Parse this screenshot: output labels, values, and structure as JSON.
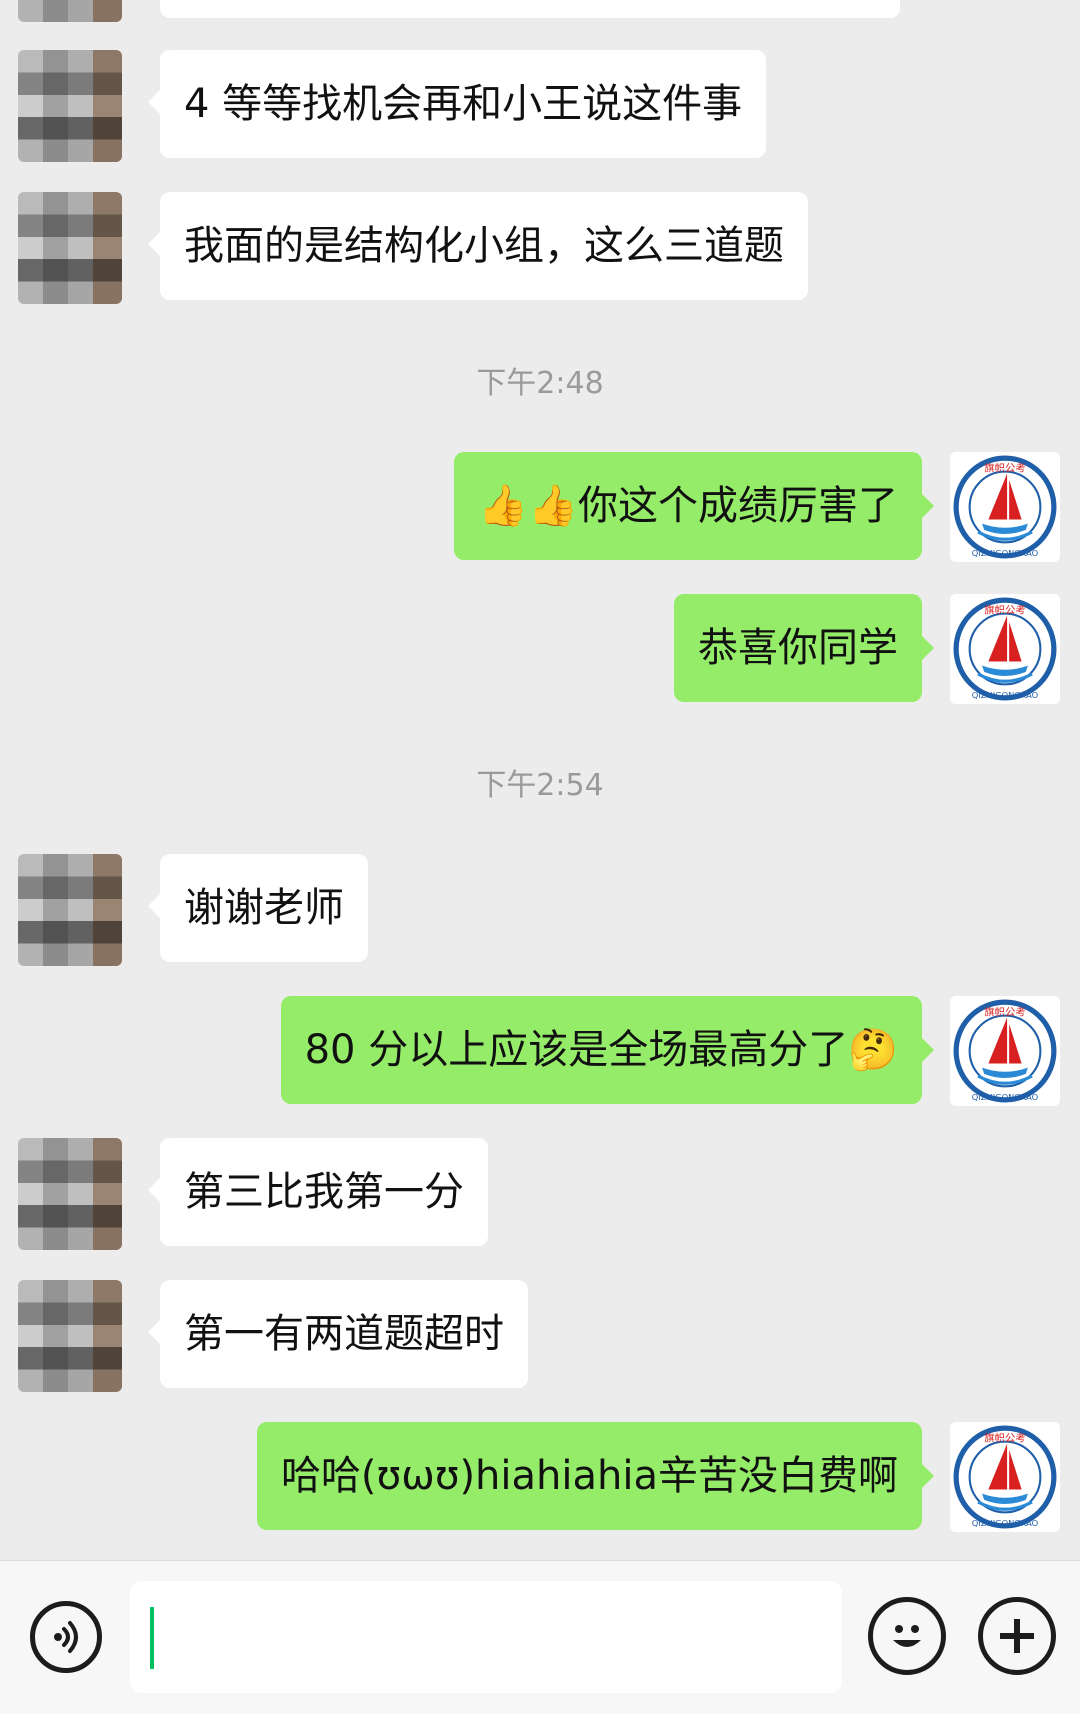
{
  "messages": [
    {
      "side": "left",
      "text": "4 等等找机会再和小王说这件事"
    },
    {
      "side": "left",
      "text": "我面的是结构化小组，这么三道题"
    },
    {
      "time": "下午2:48"
    },
    {
      "side": "right",
      "text": "👍👍你这个成绩厉害了"
    },
    {
      "side": "right",
      "text": "恭喜你同学"
    },
    {
      "time": "下午2:54"
    },
    {
      "side": "left",
      "text": "谢谢老师"
    },
    {
      "side": "right",
      "text": "80 分以上应该是全场最高分了🤔"
    },
    {
      "side": "left",
      "text": "第三比我第一分"
    },
    {
      "side": "left",
      "text": "第一有两道题超时"
    },
    {
      "side": "right",
      "text": "哈哈(ʊωʊ)hiahiahia辛苦没白费啊"
    }
  ],
  "logo": {
    "top_text": "旗帜公考",
    "bottom_text": "QIZHIGONGKAO",
    "colors": {
      "ring": "#1f5ea8",
      "sail": "#d82020",
      "water": "#2b8ad6"
    }
  },
  "input": {
    "value": ""
  },
  "icons": {
    "voice": "voice-icon",
    "emoji": "emoji-icon",
    "plus": "plus-icon"
  }
}
